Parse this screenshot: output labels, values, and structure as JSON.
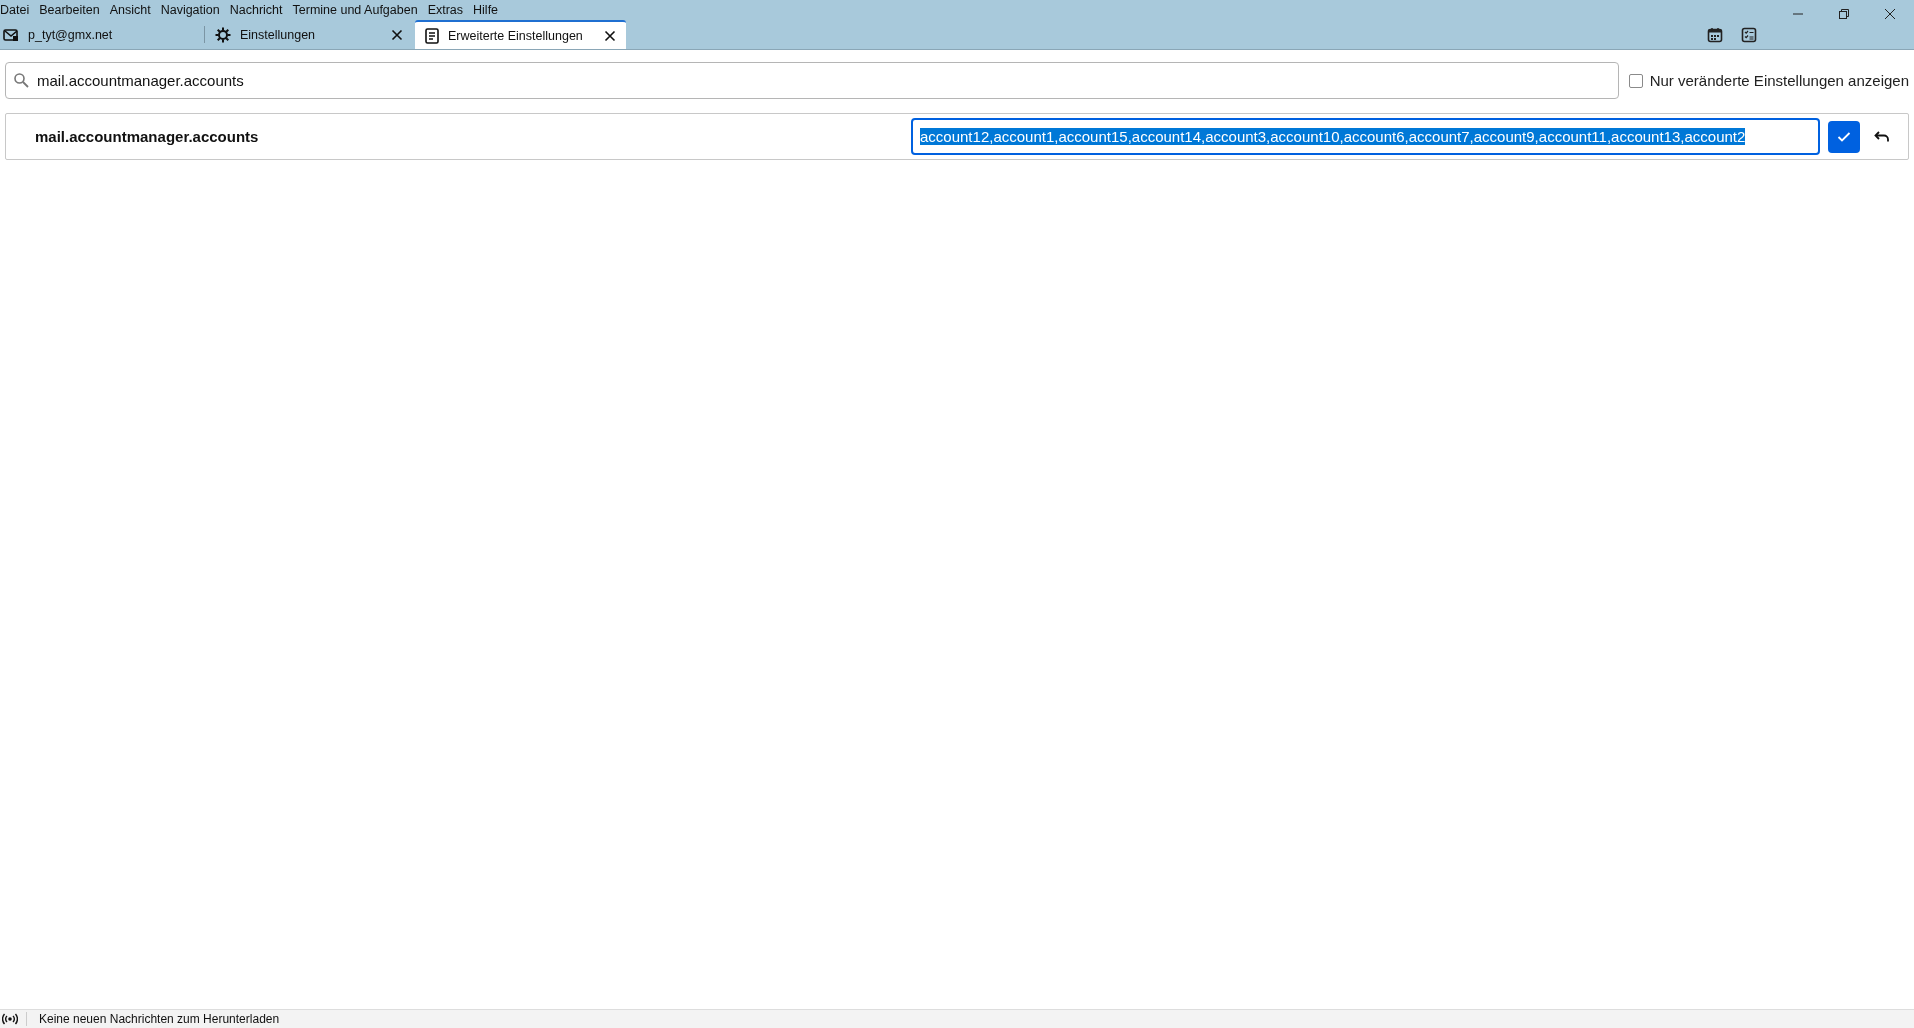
{
  "menu_bar": [
    "Datei",
    "Bearbeiten",
    "Ansicht",
    "Navigation",
    "Nachricht",
    "Termine und Aufgaben",
    "Extras",
    "Hilfe"
  ],
  "tabs": [
    {
      "label": "p_tyt@gmx.net",
      "kind": "mail",
      "closable": false,
      "selected": false
    },
    {
      "label": "Einstellungen",
      "kind": "gear",
      "closable": true,
      "selected": false
    },
    {
      "label": "Erweiterte Einstellungen",
      "kind": "document",
      "closable": true,
      "selected": true
    }
  ],
  "search": {
    "value": "mail.accountmanager.accounts"
  },
  "filter_checkbox": {
    "label": "Nur veränderte Einstellungen anzeigen",
    "checked": false
  },
  "preference": {
    "name": "mail.accountmanager.accounts",
    "value": "account12,account1,account15,account14,account3,account10,account6,account7,account9,account11,account13,account2",
    "text_selected": true
  },
  "status_bar": {
    "text": "Keine neuen Nachrichten zum Herunterladen"
  }
}
